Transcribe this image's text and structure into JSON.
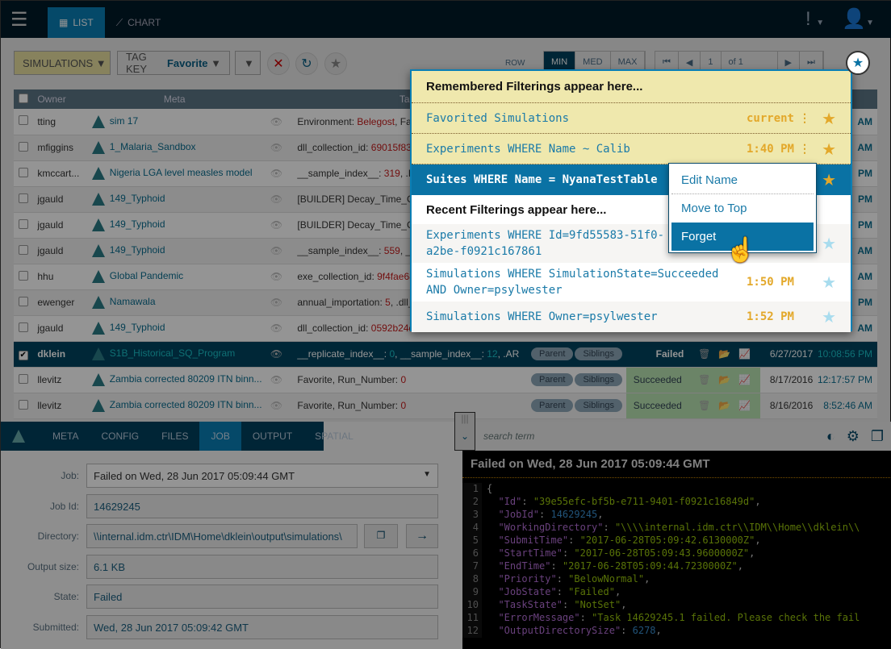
{
  "nav": {
    "tabs": [
      {
        "label": "LIST",
        "icon": "grid-icon",
        "active": true
      },
      {
        "label": "CHART",
        "icon": "line-chart-icon",
        "active": false
      }
    ]
  },
  "toolbar": {
    "entity": "SIMULATIONS",
    "tag_key_label": "TAG KEY",
    "tag_key_value": "Favorite",
    "row_label": "ROW",
    "sizes": [
      "MIN",
      "MED",
      "MAX"
    ],
    "selected_size": "MIN",
    "page": "1",
    "of": "of 1"
  },
  "table": {
    "headers": [
      "Owner",
      "Meta",
      "Tags"
    ],
    "rows": [
      {
        "owner": "tting",
        "name": "sim 17",
        "tags": [
          [
            "Environment",
            "Belegost"
          ],
          [
            "Fa",
            ""
          ]
        ],
        "time": "AM"
      },
      {
        "owner": "mfiggins",
        "name": "1_Malaria_Sandbox",
        "tags": [
          [
            "dll_collection_id",
            "69015f83-"
          ]
        ],
        "time": "AM"
      },
      {
        "owner": "kmccart...",
        "name": "Nigeria LGA level measles model",
        "tags": [
          [
            "__sample_index__",
            "319"
          ],
          [
            ".Ba",
            ""
          ]
        ],
        "time": "PM"
      },
      {
        "owner": "jgauld",
        "name": "149_Typhoid",
        "tags": [
          [
            "[BUILDER] Decay_Time_Con",
            ""
          ]
        ],
        "time": "PM"
      },
      {
        "owner": "jgauld",
        "name": "149_Typhoid",
        "tags": [
          [
            "[BUILDER] Decay_Time_Con",
            ""
          ]
        ],
        "time": "PM"
      },
      {
        "owner": "jgauld",
        "name": "149_Typhoid",
        "tags": [
          [
            "__sample_index__",
            "559"
          ],
          [
            "__",
            ""
          ]
        ],
        "time": "AM"
      },
      {
        "owner": "hhu",
        "name": "Global Pandemic",
        "tags": [
          [
            "exe_collection_id",
            "9f4fae68"
          ]
        ],
        "time": "AM"
      },
      {
        "owner": "ewenger",
        "name": "Namawala",
        "tags": [
          [
            "annual_importation",
            "5"
          ],
          [
            ".dll_",
            ""
          ]
        ],
        "time": "PM"
      },
      {
        "owner": "jgauld",
        "name": "149_Typhoid",
        "tags": [
          [
            "dll_collection_id",
            "0592b24d"
          ]
        ],
        "time": "AM"
      },
      {
        "owner": "dklein",
        "name": "S1B_Historical_SQ_Program",
        "tags": [
          [
            "__replicate_index__",
            "0"
          ],
          [
            "__sample_index__",
            "12"
          ],
          [
            ".AR",
            ""
          ]
        ],
        "parent": "Parent",
        "siblings": "Siblings",
        "status": "Failed",
        "date": "6/27/2017",
        "time": "10:08:56 PM",
        "selected": true
      },
      {
        "owner": "llevitz",
        "name": "Zambia corrected 80209 ITN binn...",
        "tags": [
          [
            "Favorite",
            ""
          ],
          [
            "Run_Number",
            "0"
          ]
        ],
        "parent": "Parent",
        "siblings": "Siblings",
        "status": "Succeeded",
        "date": "8/17/2016",
        "time": "12:17:57 PM"
      },
      {
        "owner": "llevitz",
        "name": "Zambia corrected 80209 ITN binn...",
        "tags": [
          [
            "Favorite",
            ""
          ],
          [
            "Run_Number",
            "0"
          ]
        ],
        "parent": "Parent",
        "siblings": "Siblings",
        "status": "Succeeded",
        "date": "8/16/2016",
        "time": "8:52:46 AM"
      }
    ]
  },
  "popup": {
    "remembered_header": "Remembered Filterings appear here...",
    "remembered": [
      {
        "label": "Favorited Simulations",
        "time": "current"
      },
      {
        "label": "Experiments WHERE Name ~ Calib",
        "time": "1:40 PM"
      },
      {
        "label": "Suites WHERE Name = NyanaTestTable",
        "time": ""
      }
    ],
    "recent_header": "Recent Filterings appear here...",
    "recent": [
      {
        "label": "Experiments WHERE Id=9fd55583-51f0-",
        "label2": "a2be-f0921c167861",
        "time": ""
      },
      {
        "label": "Simulations WHERE SimulationState=Succeeded",
        "label2": "AND Owner=psylwester",
        "time": "1:50 PM"
      },
      {
        "label": "Simulations WHERE Owner=psylwester",
        "label2": "",
        "time": "1:52 PM"
      }
    ],
    "menu": [
      "Edit Name",
      "Move to Top",
      "Forget"
    ]
  },
  "details": {
    "tabs": [
      "META",
      "CONFIG",
      "FILES",
      "JOB",
      "OUTPUT",
      "SPATIAL"
    ],
    "active_tab": "JOB",
    "fields": [
      {
        "label": "Job:",
        "value": "Failed on Wed, 28 Jun 2017 05:09:44 GMT"
      },
      {
        "label": "Job Id:",
        "value": "14629245"
      },
      {
        "label": "Directory:",
        "value": "\\\\internal.idm.ctr\\IDM\\Home\\dklein\\output\\simulations\\"
      },
      {
        "label": "Output size:",
        "value": "6.1 KB"
      },
      {
        "label": "State:",
        "value": "Failed"
      },
      {
        "label": "Submitted:",
        "value": "Wed, 28 Jun 2017 05:09:42 GMT"
      }
    ]
  },
  "output": {
    "search_placeholder": "search term",
    "title": "Failed on Wed, 28 Jun 2017 05:09:44 GMT",
    "lines": [
      [
        "{",
        "",
        ""
      ],
      [
        "\"Id\"",
        "\"39e55efc-bf5b-e711-9401-f0921c16849d\"",
        "s"
      ],
      [
        "\"JobId\"",
        "14629245",
        "num"
      ],
      [
        "\"WorkingDirectory\"",
        "\"\\\\\\\\internal.idm.ctr\\\\IDM\\\\Home\\\\dklein\\\\",
        "s"
      ],
      [
        "\"SubmitTime\"",
        "\"2017-06-28T05:09:42.6130000Z\"",
        "s"
      ],
      [
        "\"StartTime\"",
        "\"2017-06-28T05:09:43.9600000Z\"",
        "s"
      ],
      [
        "\"EndTime\"",
        "\"2017-06-28T05:09:44.7230000Z\"",
        "s"
      ],
      [
        "\"Priority\"",
        "\"BelowNormal\"",
        "s"
      ],
      [
        "\"JobState\"",
        "\"Failed\"",
        "s"
      ],
      [
        "\"TaskState\"",
        "\"NotSet\"",
        "s"
      ],
      [
        "\"ErrorMessage\"",
        "\"Task 14629245.1 failed. Please check the fail",
        "s"
      ],
      [
        "\"OutputDirectorySize\"",
        "6278",
        "num"
      ]
    ]
  },
  "colors": {
    "accent": "#0a72a4",
    "star": "#e3a82a",
    "failed": "#cc0000",
    "succeeded": "#b8e3b2"
  }
}
